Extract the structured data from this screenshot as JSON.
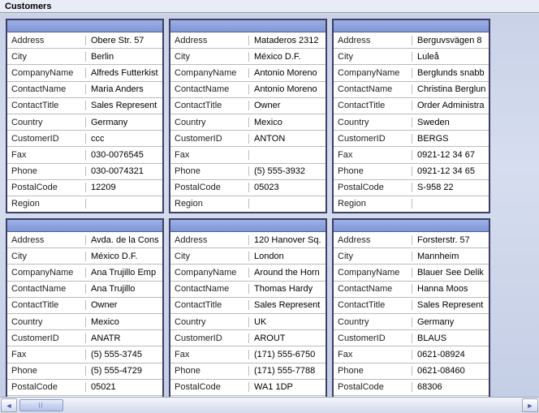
{
  "title": "Customers",
  "fields": [
    "Address",
    "City",
    "CompanyName",
    "ContactName",
    "ContactTitle",
    "Country",
    "CustomerID",
    "Fax",
    "Phone",
    "PostalCode",
    "Region"
  ],
  "records": [
    {
      "Address": "Obere Str. 57",
      "City": "Berlin",
      "CompanyName": "Alfreds Futterkist",
      "ContactName": "Maria Anders",
      "ContactTitle": "Sales Represent",
      "Country": "Germany",
      "CustomerID": "ccc",
      "Fax": "030-0076545",
      "Phone": "030-0074321",
      "PostalCode": "12209",
      "Region": ""
    },
    {
      "Address": "Mataderos  2312",
      "City": "México D.F.",
      "CompanyName": "Antonio Moreno",
      "ContactName": "Antonio Moreno",
      "ContactTitle": "Owner",
      "Country": "Mexico",
      "CustomerID": "ANTON",
      "Fax": "",
      "Phone": "(5) 555-3932",
      "PostalCode": "05023",
      "Region": ""
    },
    {
      "Address": "Berguvsvägen  8",
      "City": "Luleå",
      "CompanyName": "Berglunds snabb",
      "ContactName": "Christina Berglun",
      "ContactTitle": "Order Administra",
      "Country": "Sweden",
      "CustomerID": "BERGS",
      "Fax": "0921-12 34 67",
      "Phone": "0921-12 34 65",
      "PostalCode": "S-958 22",
      "Region": ""
    },
    {
      "Address": "Avda. de la Cons",
      "City": "México D.F.",
      "CompanyName": "Ana Trujillo Emp",
      "ContactName": "Ana Trujillo",
      "ContactTitle": "Owner",
      "Country": "Mexico",
      "CustomerID": "ANATR",
      "Fax": "(5) 555-3745",
      "Phone": "(5) 555-4729",
      "PostalCode": "05021",
      "Region": ""
    },
    {
      "Address": "120 Hanover Sq.",
      "City": "London",
      "CompanyName": "Around the Horn",
      "ContactName": "Thomas Hardy",
      "ContactTitle": "Sales Represent",
      "Country": "UK",
      "CustomerID": "AROUT",
      "Fax": "(171) 555-6750",
      "Phone": "(171) 555-7788",
      "PostalCode": "WA1 1DP",
      "Region": ""
    },
    {
      "Address": "Forsterstr. 57",
      "City": "Mannheim",
      "CompanyName": "Blauer See Delik",
      "ContactName": "Hanna Moos",
      "ContactTitle": "Sales Represent",
      "Country": "Germany",
      "CustomerID": "BLAUS",
      "Fax": "0621-08924",
      "Phone": "0621-08460",
      "PostalCode": "68306",
      "Region": ""
    }
  ]
}
